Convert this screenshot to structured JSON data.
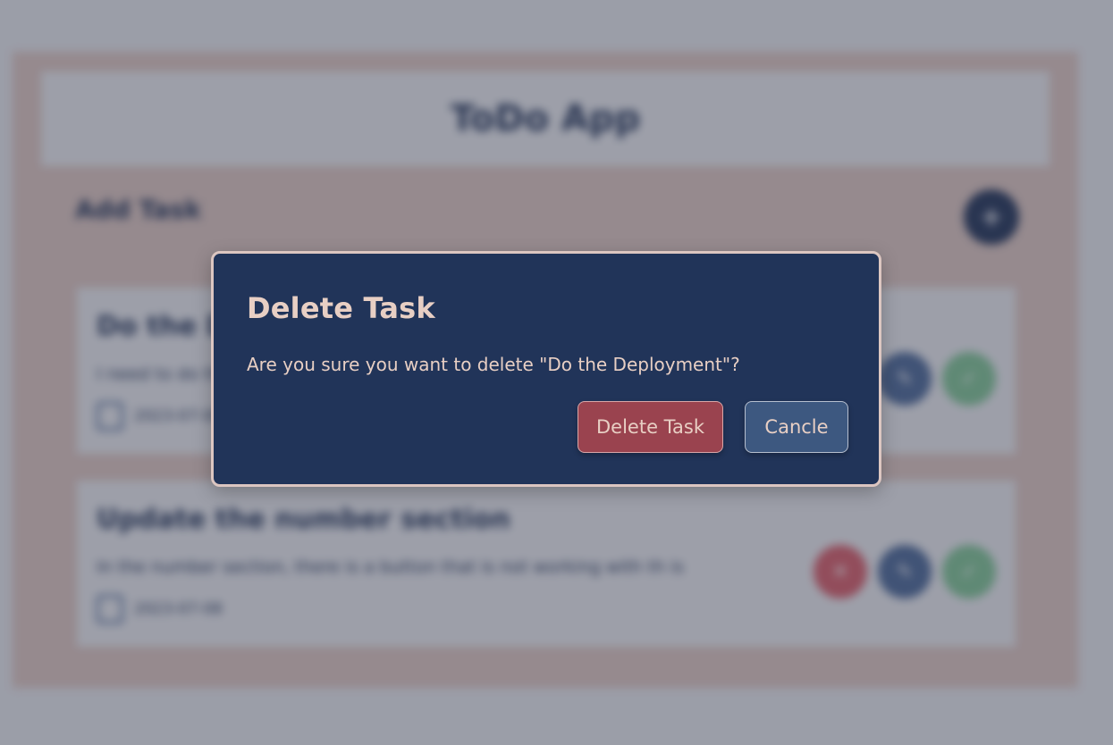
{
  "app": {
    "title": "ToDo App",
    "add_task_label": "Add Task",
    "add_button_symbol": "+"
  },
  "tasks": [
    {
      "title": "Do the Deployment",
      "description": "I need to do the deployment",
      "date": "2023-07-08"
    },
    {
      "title": "Update the number section",
      "description": "In the number section, there is a button that is not working with th is",
      "date": "2023-07-08"
    }
  ],
  "dialog": {
    "title": "Delete Task",
    "message": "Are you sure you want to delete \"Do the Deployment\"?",
    "confirm_label": "Delete Task",
    "cancel_label": "Cancle"
  },
  "colors": {
    "navy": "#213459",
    "dialog_text": "#e8cfc4",
    "delete": "#9a434f",
    "cancel": "#3d5880",
    "accent_border": "#dcc6c1"
  },
  "icons": {
    "add": "plus-icon",
    "calendar": "calendar-icon",
    "delete": "trash-icon",
    "edit": "pencil-icon",
    "complete": "check-icon"
  }
}
